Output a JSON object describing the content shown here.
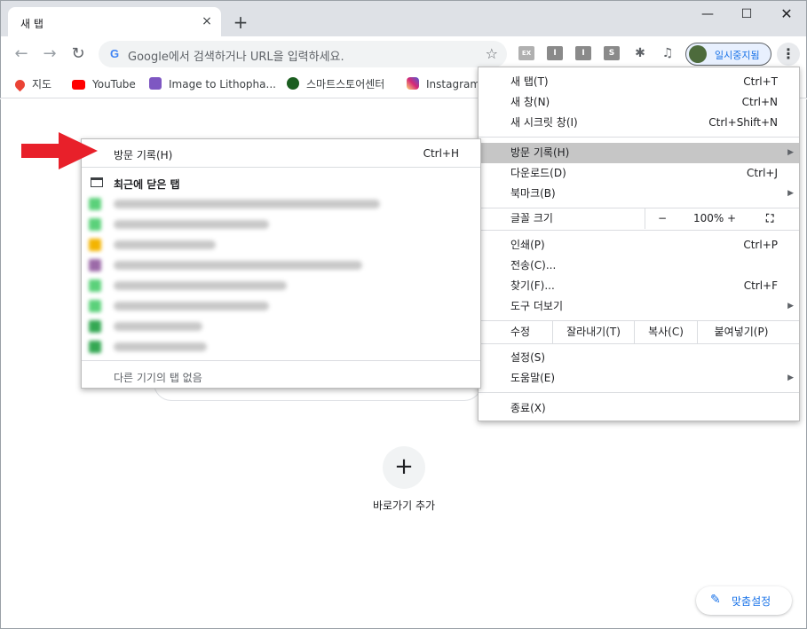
{
  "browser": {
    "tab_title": "새 탭",
    "tab_close": "×",
    "new_tab": "+",
    "window_min": "—",
    "window_max": "☐",
    "window_close": "✕"
  },
  "toolbar": {
    "back": "←",
    "forward": "→",
    "reload": "↻",
    "omnibox_placeholder": "Google에서 검색하거나 URL을 입력하세요.",
    "google_letter": "G",
    "star": "☆",
    "extensions": [
      "EX",
      "I",
      "I",
      "S"
    ],
    "puzzle": "✱",
    "media": "♫",
    "profile_label": "일시중지됨",
    "menu": "⋮"
  },
  "bookmarks": [
    {
      "label": "지도",
      "icon": "maps-pin-icon"
    },
    {
      "label": "YouTube",
      "icon": "youtube-icon"
    },
    {
      "label": "Image to Lithopha...",
      "icon": "lithophane-icon"
    },
    {
      "label": "스마트스토어센터",
      "icon": "smartstore-icon"
    },
    {
      "label": "Instagram",
      "icon": "instagram-icon"
    }
  ],
  "page": {
    "add_shortcut_icon": "+",
    "add_shortcut_label": "바로가기 추가",
    "customize_icon": "✎",
    "customize_label": "맞춤설정"
  },
  "menu": {
    "new_tab": {
      "label": "새 탭(T)",
      "shortcut": "Ctrl+T"
    },
    "new_window": {
      "label": "새 창(N)",
      "shortcut": "Ctrl+N"
    },
    "incognito": {
      "label": "새 시크릿 창(I)",
      "shortcut": "Ctrl+Shift+N"
    },
    "history": {
      "label": "방문 기록(H)",
      "arrow": "▶"
    },
    "downloads": {
      "label": "다운로드(D)",
      "shortcut": "Ctrl+J"
    },
    "bookmarks": {
      "label": "북마크(B)",
      "arrow": "▶"
    },
    "zoom": {
      "label": "글꼴 크기",
      "minus": "−",
      "value": "100%",
      "plus": "+",
      "fullscreen": "⛶"
    },
    "print": {
      "label": "인쇄(P)",
      "shortcut": "Ctrl+P"
    },
    "cast": {
      "label": "전송(C)..."
    },
    "find": {
      "label": "찾기(F)...",
      "shortcut": "Ctrl+F"
    },
    "more_tools": {
      "label": "도구 더보기",
      "arrow": "▶"
    },
    "edit": {
      "label": "수정",
      "cut": "잘라내기(T)",
      "copy": "복사(C)",
      "paste": "붙여넣기(P)"
    },
    "settings": {
      "label": "설정(S)"
    },
    "help": {
      "label": "도움말(E)",
      "arrow": "▶"
    },
    "exit": {
      "label": "종료(X)"
    }
  },
  "history_submenu": {
    "header": "방문 기록(H)",
    "header_shortcut": "Ctrl+H",
    "recently_closed": "최근에 닫은 탭",
    "no_other_devices": "다른 기기의 탭 없음",
    "items": [
      {
        "favicon_color": "#5bd17a"
      },
      {
        "favicon_color": "#5bd17a"
      },
      {
        "favicon_color": "#f4b400"
      },
      {
        "favicon_color": "#9c6aa8"
      },
      {
        "favicon_color": "#5bd17a"
      },
      {
        "favicon_color": "#5bd17a"
      },
      {
        "favicon_color": "#34a853"
      },
      {
        "favicon_color": "#34a853"
      }
    ]
  },
  "colors": {
    "accent": "#1a73e8",
    "highlight": "#c6c6c6",
    "arrow_red": "#e8202a"
  }
}
